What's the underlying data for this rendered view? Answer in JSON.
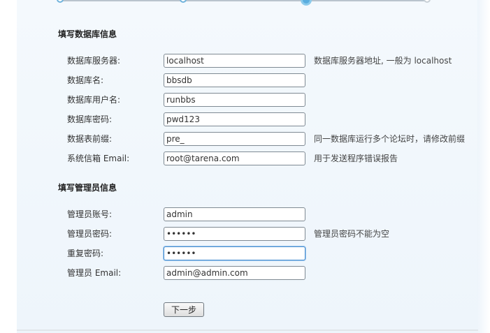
{
  "progress": {
    "steps": [
      "done",
      "done",
      "current",
      "pending"
    ]
  },
  "db_section": {
    "title": "填写数据库信息",
    "fields": [
      {
        "label": "数据库服务器:",
        "value": "localhost",
        "hint": "数据库服务器地址, 一般为 localhost"
      },
      {
        "label": "数据库名:",
        "value": "bbsdb",
        "hint": ""
      },
      {
        "label": "数据库用户名:",
        "value": "runbbs",
        "hint": ""
      },
      {
        "label": "数据库密码:",
        "value": "pwd123",
        "hint": ""
      },
      {
        "label": "数据表前缀:",
        "value": "pre_",
        "hint": "同一数据库运行多个论坛时，请修改前缀"
      },
      {
        "label": "系统信箱 Email:",
        "value": "root@tarena.com",
        "hint": "用于发送程序错误报告"
      }
    ]
  },
  "admin_section": {
    "title": "填写管理员信息",
    "fields": [
      {
        "label": "管理员账号:",
        "value": "admin",
        "hint": ""
      },
      {
        "label": "管理员密码:",
        "value": "••••••",
        "hint": "管理员密码不能为空"
      },
      {
        "label": "重复密码:",
        "value": "••••••",
        "hint": ""
      },
      {
        "label": "管理员 Email:",
        "value": "admin@admin.com",
        "hint": ""
      }
    ]
  },
  "next_button": {
    "label": "下一步"
  }
}
